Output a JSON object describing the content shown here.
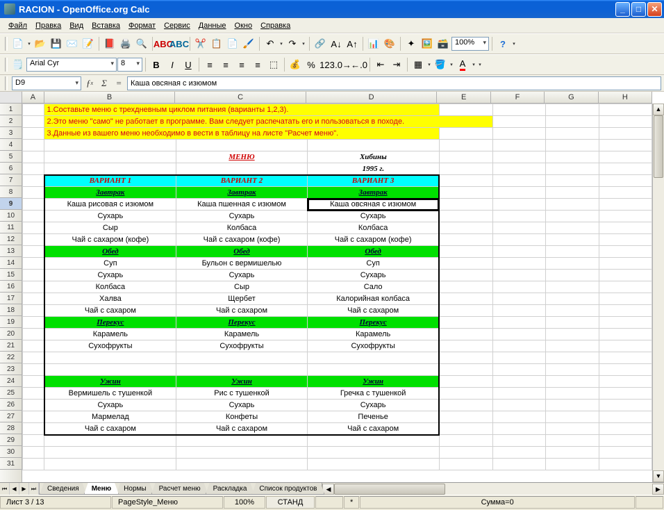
{
  "window": {
    "title": "RACION - OpenOffice.org Calc"
  },
  "menus": [
    "Файл",
    "Правка",
    "Вид",
    "Вставка",
    "Формат",
    "Сервис",
    "Данные",
    "Окно",
    "Справка"
  ],
  "toolbar": {
    "zoom": "100%"
  },
  "format": {
    "font": "Arial Cyr",
    "size": "8"
  },
  "formula": {
    "cellref": "D9",
    "value": "Каша овсяная с изюмом"
  },
  "columns": [
    "A",
    "B",
    "C",
    "D",
    "E",
    "F",
    "G",
    "H"
  ],
  "rows": [
    1,
    2,
    3,
    4,
    5,
    6,
    7,
    8,
    9,
    10,
    11,
    12,
    13,
    14,
    15,
    16,
    17,
    18,
    19,
    20,
    21,
    22,
    23,
    24,
    25,
    26,
    27,
    28,
    29,
    30,
    31
  ],
  "instr": {
    "l1": "1.Составьте меню с трехдневным циклом питания (варианты 1,2,3).",
    "l2": "2.Это меню \"само\" не работает в программе. Вам следует распечатать его и пользоваться в походе.",
    "l3": "3.Данные из вашего меню необходимо в вести в таблицу на листе \"Расчет меню\"."
  },
  "title_row": {
    "menu": "МЕНЮ",
    "loc": "Хибины",
    "year": "1995 г."
  },
  "variants": [
    "ВАРИАНТ 1",
    "ВАРИАНТ 2",
    "ВАРИАНТ 3"
  ],
  "sections": {
    "breakfast": "Завтрак",
    "lunch": "Обед",
    "snack": "Перекус",
    "dinner": "Ужин"
  },
  "menu_data": {
    "breakfast": [
      [
        "Каша рисовая с изюмом",
        "Каша пшенная с изюмом",
        "Каша овсяная с изюмом"
      ],
      [
        "Сухарь",
        "Сухарь",
        "Сухарь"
      ],
      [
        "Сыр",
        "Колбаса",
        "Колбаса"
      ],
      [
        "Чай с сахаром (кофе)",
        "Чай с сахаром (кофе)",
        "Чай с сахаром (кофе)"
      ]
    ],
    "lunch": [
      [
        "Суп",
        "Бульон с вермишелью",
        "Суп"
      ],
      [
        "Сухарь",
        "Сухарь",
        "Сухарь"
      ],
      [
        "Колбаса",
        "Сыр",
        "Сало"
      ],
      [
        "Халва",
        "Щербет",
        "Калорийная колбаса"
      ],
      [
        "Чай с сахаром",
        "Чай с сахаром",
        "Чай с сахаром"
      ]
    ],
    "snack": [
      [
        "Карамель",
        "Карамель",
        "Карамель"
      ],
      [
        "Сухофрукты",
        "Сухофрукты",
        "Сухофрукты"
      ]
    ],
    "dinner": [
      [
        "Вермишель с тушенкой",
        "Рис с тушенкой",
        "Гречка с тушенкой"
      ],
      [
        "Сухарь",
        "Сухарь",
        "Сухарь"
      ],
      [
        "Мармелад",
        "Конфеты",
        "Печенье"
      ],
      [
        "Чай с сахаром",
        "Чай с сахаром",
        "Чай с сахаром"
      ]
    ]
  },
  "tabs": [
    "Сведения",
    "Меню",
    "Нормы",
    "Расчет меню",
    "Раскладка",
    "Список продуктов"
  ],
  "active_tab": 1,
  "status": {
    "sheet": "Лист 3 / 13",
    "style": "PageStyle_Меню",
    "zoom": "100%",
    "mode": "СТАНД",
    "extra": "*",
    "sum": "Сумма=0"
  }
}
